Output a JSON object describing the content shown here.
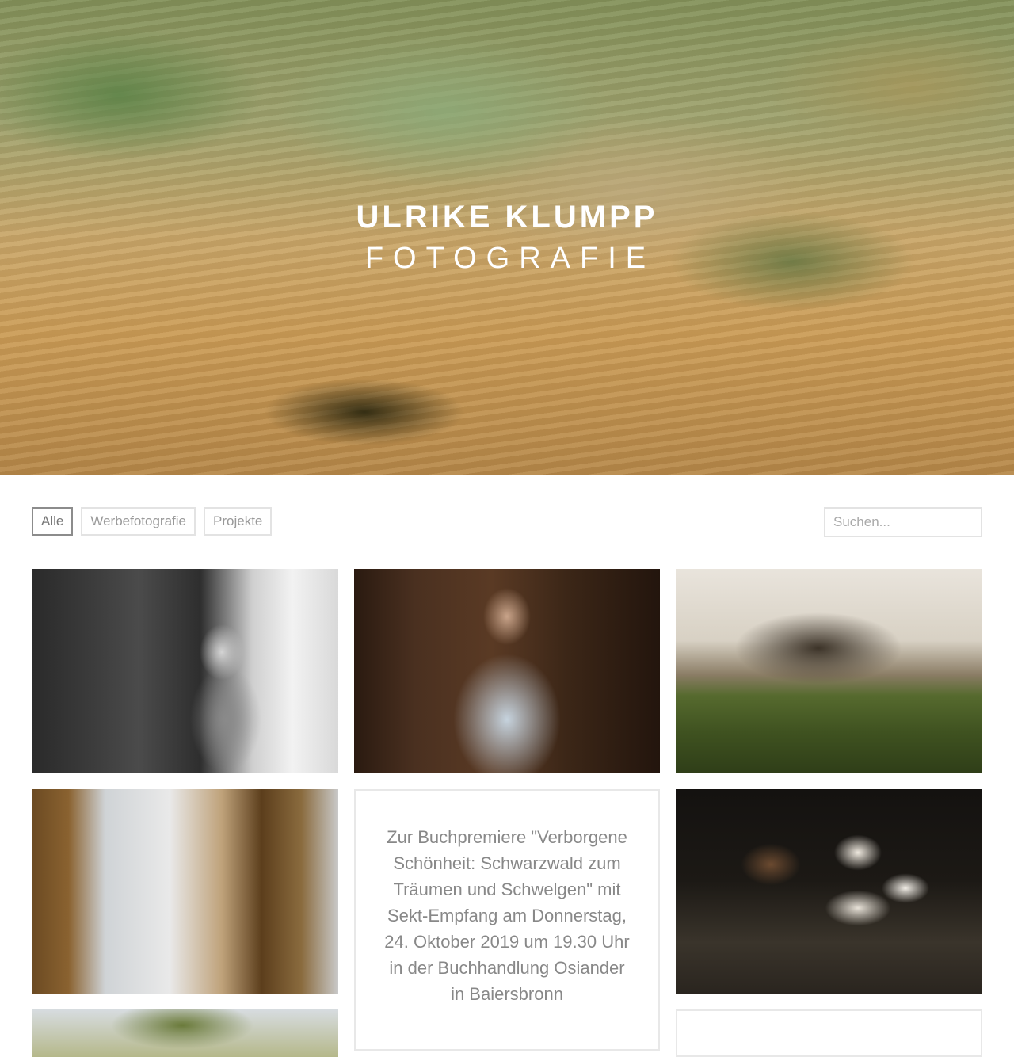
{
  "hero": {
    "title_line1": "ULRIKE KLUMPP",
    "title_line2": "FOTOGRAFIE"
  },
  "filters": [
    {
      "label": "Alle",
      "active": true
    },
    {
      "label": "Werbefotografie",
      "active": false
    },
    {
      "label": "Projekte",
      "active": false
    }
  ],
  "search": {
    "placeholder": "Suchen..."
  },
  "gallery": {
    "text_post": "Zur Buchpremiere \"Verborgene Schönheit: Schwarzwald zum Träumen und Schwelgen\" mit Sekt-Empfang am Donnerstag, 24. Oktober 2019 um 19.30 Uhr in der Buchhandlung Osiander in Baiersbronn"
  },
  "colors": {
    "filter_border": "#e3e3e3",
    "filter_active_border": "#8c8c8c",
    "text": "#888888"
  }
}
